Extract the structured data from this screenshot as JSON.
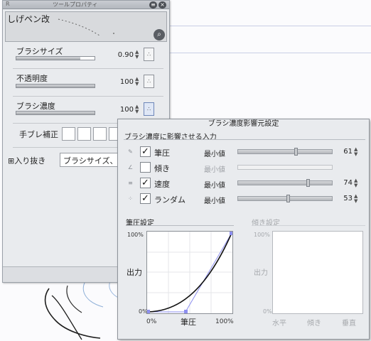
{
  "tool_panel": {
    "title": "ツールプロパティ",
    "tag": "R",
    "close_glyph": "×",
    "menu_glyph": "≡",
    "preview": {
      "brush_name": "しげペン改",
      "zoom_icon": "magnifier-icon"
    },
    "properties": [
      {
        "label": "ブラシサイズ",
        "value": "0.90",
        "fill": 0.82
      },
      {
        "label": "不透明度",
        "value": "100",
        "fill": 1.0
      },
      {
        "label": "ブラシ濃度",
        "value": "100",
        "fill": 1.0
      }
    ],
    "correction_label": "手ブレ補正",
    "taper_label": "入り抜き",
    "taper_value": "ブラシサイズ、ブ"
  },
  "dialog": {
    "title": "ブラシ濃度影響元設定",
    "subtitle": "ブラシ濃度に影響させる入力",
    "inputs": [
      {
        "name": "筆圧",
        "checked": true,
        "min_label": "最小値",
        "value": "61",
        "level": 0.61,
        "enabled": true
      },
      {
        "name": "傾き",
        "checked": false,
        "min_label": "最小値",
        "value": "",
        "level": null,
        "enabled": false
      },
      {
        "name": "速度",
        "checked": true,
        "min_label": "最小値",
        "value": "74",
        "level": 0.74,
        "enabled": true
      },
      {
        "name": "ランダム",
        "checked": true,
        "min_label": "最小値",
        "value": "53",
        "level": 0.53,
        "enabled": true
      }
    ],
    "pressure_graph": {
      "title": "筆圧設定",
      "y_top": "100%",
      "y_bottom": "0%",
      "x_left": "0%",
      "x_right": "100%",
      "y_label": "出力",
      "x_label": "筆圧"
    },
    "tilt_graph": {
      "title": "傾き設定",
      "y_top": "100%",
      "y_bottom": "0%",
      "y_label": "出力",
      "x_labels": [
        "水平",
        "傾き",
        "垂直"
      ]
    }
  }
}
